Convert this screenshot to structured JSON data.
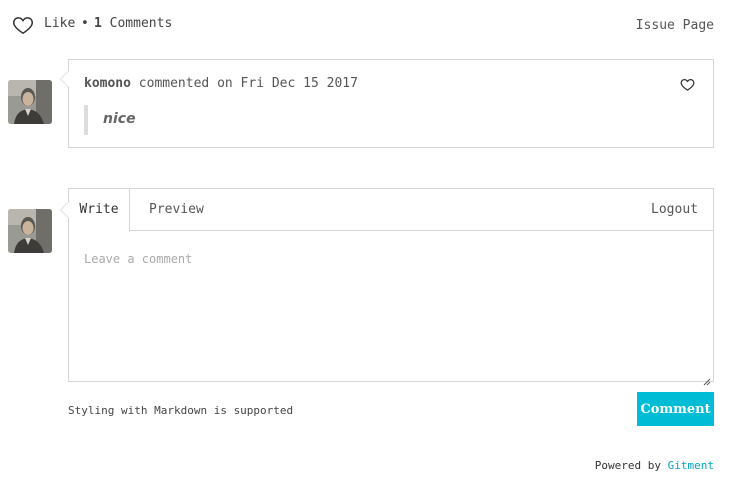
{
  "header": {
    "like_label": "Like",
    "separator": "•",
    "comment_count": "1",
    "comments_label": "Comments",
    "issue_link": "Issue Page"
  },
  "comments": [
    {
      "author": "komono",
      "action": "commented on",
      "date": "Fri Dec 15 2017",
      "body": "nice"
    }
  ],
  "editor": {
    "tab_write": "Write",
    "tab_preview": "Preview",
    "logout": "Logout",
    "placeholder": "Leave a comment",
    "markdown_tip": "Styling with Markdown is supported",
    "submit_label": "Comment"
  },
  "footer": {
    "powered_by": "Powered by",
    "brand": "Gitment"
  },
  "colors": {
    "accent": "#00bcd4",
    "link": "#00a4c8",
    "border": "#d6d6d6"
  },
  "icons": [
    "heart-icon",
    "avatar-image",
    "resize-grip-icon"
  ]
}
